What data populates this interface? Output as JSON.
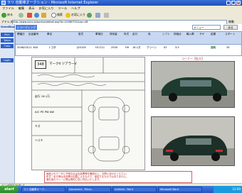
{
  "window": {
    "title": "ラリ 自動車オークション - Microsoft Internet Explorer",
    "controls": [
      "_",
      "□",
      "×"
    ]
  },
  "menubar": {
    "items": [
      "ファイル",
      "編集",
      "表示",
      "お気に入り",
      "ツール",
      "ヘルプ"
    ]
  },
  "toolbar": {
    "back_label": "戻る",
    "search_label": "検索",
    "favorites_label": "お気に入り"
  },
  "address": {
    "label": "アドレス",
    "url": "http://www.xxxx.jp/auction/detail.asp?id=20060701&no=46",
    "go_label": "移動"
  },
  "left_panel": {
    "brand": "OmniBuzz",
    "buttons": [
      "Mon",
      "Tokyo",
      "Time",
      "Login"
    ]
  },
  "page_header": {
    "home_label": "レコーディング",
    "right_buttons": [
      "メニュー",
      "戻る"
    ]
  },
  "table": {
    "headers": [
      "開催日",
      "出品番号",
      "車名",
      "型式",
      "車検日",
      "排気量",
      "年式",
      "走行",
      "色",
      "シフト",
      "評価点",
      "輸入車",
      "サゲ",
      "結果",
      "スタート"
    ],
    "row": [
      "2006/03/11",
      "348",
      "トヨタ",
      "JZX100",
      "H17/11",
      "2500",
      "H9",
      "18.1万",
      "グリーン",
      "AT",
      "3.5",
      "",
      "",
      "成約",
      "35"
    ]
  },
  "corner_label": "コーナー【拡大】",
  "sheet": {
    "lot": "348",
    "model": "マークII ツアラーV",
    "notes": [
      "走行 18.1万",
      "A/C PS PW AW",
      "キズ",
      "ヘコミ"
    ]
  },
  "notice": {
    "lines": [
      "画面上のデータに不明な点は出品票等を確認の上、お問い合わせください。",
      "年式・走行等は出品票の記載によるもので、保証するものではありません。",
      "落札後のクレーム等は規約に従い対応いたします。"
    ]
  },
  "status": {
    "text": "ページが表示されました"
  },
  "taskbar": {
    "start_label": "start",
    "tasks": [
      "ラリ 自動車オーク...",
      "Document - Micro...",
      "Untitled - Paint",
      "Microsoft Word"
    ],
    "clock": "12:00"
  }
}
